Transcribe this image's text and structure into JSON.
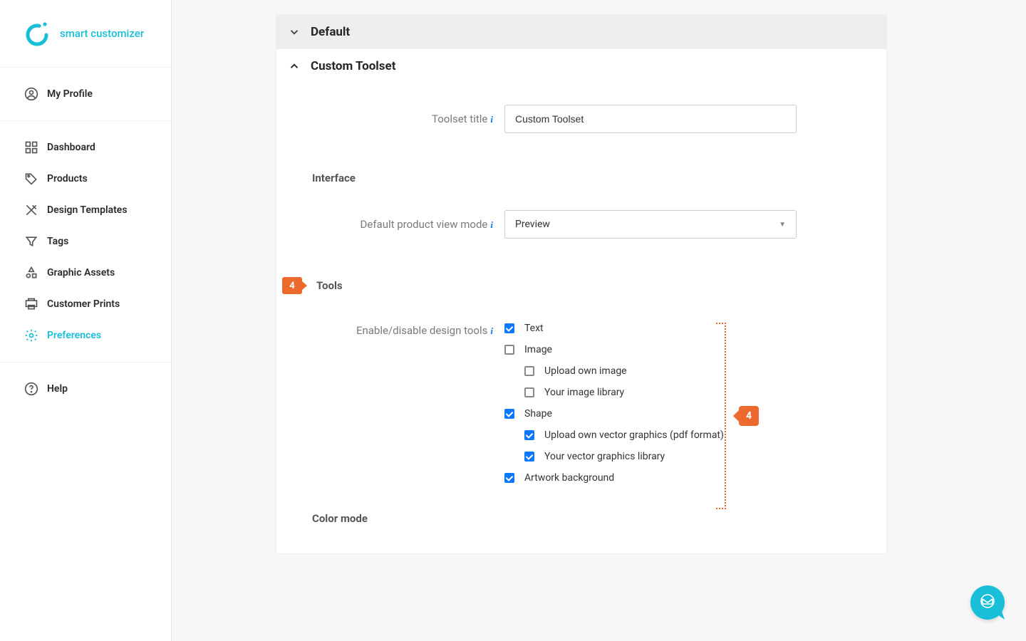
{
  "brand": {
    "name": "smart customizer"
  },
  "nav": {
    "profile": "My Profile",
    "items": [
      {
        "label": "Dashboard"
      },
      {
        "label": "Products"
      },
      {
        "label": "Design Templates"
      },
      {
        "label": "Tags"
      },
      {
        "label": "Graphic Assets"
      },
      {
        "label": "Customer Prints"
      },
      {
        "label": "Preferences"
      }
    ],
    "help": "Help"
  },
  "sections": {
    "default": {
      "title": "Default"
    },
    "custom_toolset": {
      "title": "Custom Toolset"
    }
  },
  "form": {
    "toolset_title_label": "Toolset title",
    "toolset_title_value": "Custom Toolset",
    "interface_heading": "Interface",
    "default_view_label": "Default product view mode",
    "default_view_value": "Preview",
    "tools_heading": "Tools",
    "enable_tools_label": "Enable/disable design tools",
    "color_mode_heading": "Color mode"
  },
  "tools": {
    "text": {
      "label": "Text",
      "checked": true
    },
    "image": {
      "label": "Image",
      "checked": false
    },
    "image_upload": {
      "label": "Upload own image",
      "checked": false
    },
    "image_library": {
      "label": "Your image library",
      "checked": false
    },
    "shape": {
      "label": "Shape",
      "checked": true
    },
    "shape_upload": {
      "label": "Upload own vector graphics (pdf format)",
      "checked": true
    },
    "shape_library": {
      "label": "Your vector graphics library",
      "checked": true
    },
    "artwork_bg": {
      "label": "Artwork background",
      "checked": true
    }
  },
  "steps": {
    "tools": "4",
    "bracket": "4"
  },
  "colors": {
    "accent": "#19bed8",
    "step": "#ec6a2e",
    "link": "#0b78ff"
  }
}
